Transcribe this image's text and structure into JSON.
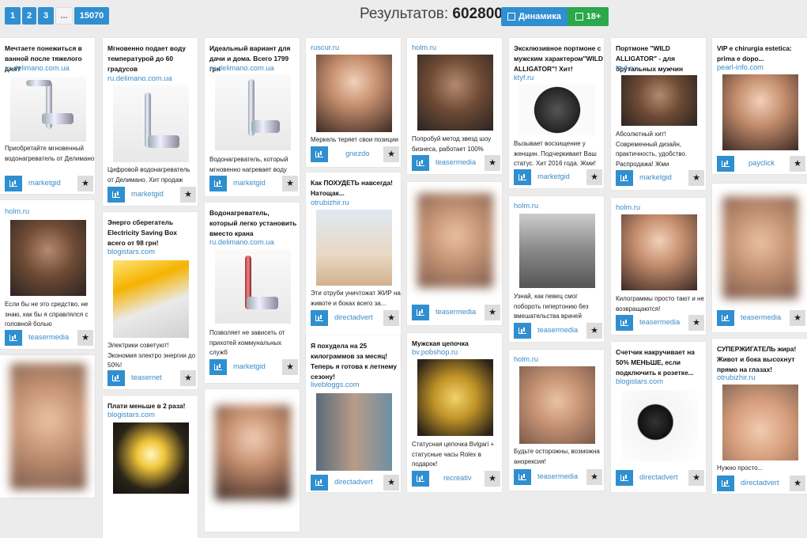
{
  "pagination": [
    "1",
    "2",
    "3",
    "...",
    "15070"
  ],
  "results": {
    "label": "Результатов:",
    "count": "602800"
  },
  "buttons": {
    "dynamics": "Динамика",
    "age": "18+"
  },
  "columns": [
    [
      {
        "title": "Мечтаете понежиться в ванной после тяжелого дня?",
        "domain": "ru.delimano.com.ua",
        "desc": "Приобретайте мгновенный водонагреватель от Делимано",
        "network": "marketgid"
      },
      {
        "title": "",
        "domain": "holm.ru",
        "desc": "Если бы не это средство, не знаю, как бы я справлялся с головной болью",
        "network": "teasermedia"
      }
    ],
    [
      {
        "title": "Мгновенно подает воду температурой до 60 градусов",
        "domain": "ru.delimano.com.ua",
        "desc": "Цифровой водонагреватель от Делимано. Хит продаж",
        "network": "marketgid"
      },
      {
        "title": "Энерго сберегатель Electricity Saving Box всего от 98 грн!",
        "domain": "blogistars.com",
        "desc": "Электрики советуют! Экономия электро энергии до 50%!",
        "network": "teasernet"
      },
      {
        "title": "Плати меньше в 2 раза!",
        "domain": "blogistars.com",
        "desc": "",
        "network": ""
      }
    ],
    [
      {
        "title": "Идеальный вариант для дачи и дома. Всего 1799 грн",
        "domain": "ru.delimano.com.ua",
        "desc": "Водонагреватель, который мгновенно нагревает воду",
        "network": "marketgid"
      },
      {
        "title": "Водонагреватель, который легко установить вместо крана",
        "domain": "ru.delimano.com.ua",
        "desc": "Позволяет не зависеть от прихотей коммунальных служб",
        "network": "marketgid"
      }
    ],
    [
      {
        "title": "",
        "domain": "ruscur.ru",
        "desc": "Меркель теряет свои позиции",
        "network": "gnezdo"
      },
      {
        "title": "Как ПОХУДЕТЬ навсегда! Натощак...",
        "domain": "otrubizhir.ru",
        "desc": "Эти отруби уничтожат ЖИР на животе и боках всего за...",
        "network": "directadvert"
      },
      {
        "title": "Я похудела на 25 килограммов за месяц! Теперь я готова к летнему сезону!",
        "domain": "livebloggs.com",
        "desc": "",
        "network": "directadvert"
      }
    ],
    [
      {
        "title": "",
        "domain": "holm.ru",
        "desc": "Попробуй метод звезд шоу бизнеса, работает 100%",
        "network": "teasermedia"
      },
      {
        "title": "",
        "domain": "",
        "desc": "",
        "network": "teasermedia"
      },
      {
        "title": "Мужская цепочка",
        "domain": "bv.pobshop.ru",
        "desc": "Статусная цепочка Bvlgari + статусные часы Rolex в подарок!",
        "network": "recreativ"
      }
    ],
    [
      {
        "title": "Эксклюзивное портмоне с мужским характером\"WILD ALLIGATOR\"! Хит!",
        "domain": "ktyf.ru",
        "desc": "Вызывает восхищение у женщин. Подчеркивает Ваш статус. Хит 2016 года. Жми!",
        "network": "marketgid"
      },
      {
        "title": "",
        "domain": "holm.ru",
        "desc": "Узнай, как певец смог побороть гипертонию без вмешательства врачей",
        "network": "teasermedia"
      },
      {
        "title": "",
        "domain": "holm.ru",
        "desc": "Будьте осторожны, возможна анорексия!",
        "network": "teasermedia"
      }
    ],
    [
      {
        "title": "Портмоне \"WILD ALLIGATOR\" - для брутальных мужчин",
        "domain": "ktyf.ru",
        "desc": "Абсолютный хит! Современный дизайн, практичность, удобство. Распродажа! Жми",
        "network": "marketgid"
      },
      {
        "title": "",
        "domain": "holm.ru",
        "desc": "Килограммы просто тают и не возвращаются!",
        "network": "teasermedia"
      },
      {
        "title": "Счетчик накручивает на 50% МЕНЬШЕ, если подключить к розетке...",
        "domain": "blogistars.com",
        "desc": "",
        "network": "directadvert"
      }
    ],
    [
      {
        "title": "VIP e chirurgia estetica: prima e dopo...",
        "domain": "pearl-info.com",
        "desc": "",
        "network": "payclick"
      },
      {
        "title": "",
        "domain": "",
        "desc": "",
        "network": "teasermedia"
      },
      {
        "title": "СУПЕРЖИГАТЕЛЬ жира! Живот и бока высохнут прямо на глазах!",
        "domain": "otrubizhir.ru",
        "desc": "Нужно просто...",
        "network": "directadvert"
      }
    ]
  ],
  "colors": {
    "accent": "#2f8fd0",
    "green": "#2ba84a",
    "link": "#3b8bc8"
  }
}
